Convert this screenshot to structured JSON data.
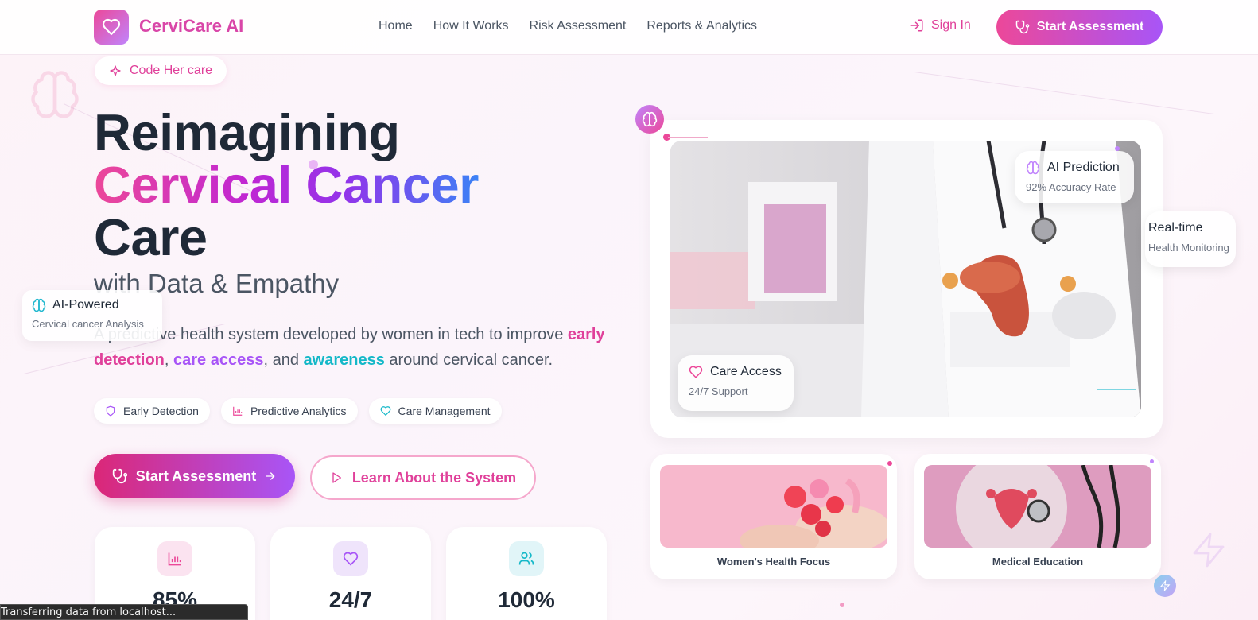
{
  "header": {
    "brand": "CerviCare AI",
    "nav": [
      "Home",
      "How It Works",
      "Risk Assessment",
      "Reports & Analytics"
    ],
    "sign_in": "Sign In",
    "start_assessment": "Start Assessment"
  },
  "hero": {
    "badge": "Code Her care",
    "title_line1": "Reimagining",
    "title_line2": "Cervical Cancer",
    "title_line3": "Care",
    "subtitle": "with Data & Empathy",
    "desc_part1": "A predictive health system developed by women in tech to improve",
    "desc_hl1": "early detection",
    "desc_sep1": ",",
    "desc_hl2": "care access",
    "desc_sep2": ", and",
    "desc_hl3": "awareness",
    "desc_part2": "around cervical cancer.",
    "pills": [
      "Early Detection",
      "Predictive Analytics",
      "Care Management"
    ],
    "primary_button": "Start Assessment",
    "secondary_button": "Learn About the System",
    "ai_powered_title": "AI-Powered",
    "ai_powered_sub": "Cervical cancer Analysis"
  },
  "stats": [
    {
      "value": "85%",
      "icon": "bar-chart-icon"
    },
    {
      "value": "24/7",
      "icon": "heart-icon"
    },
    {
      "value": "100%",
      "icon": "users-icon"
    }
  ],
  "showcase": {
    "ai_prediction_title": "AI Prediction",
    "ai_prediction_sub": "92% Accuracy Rate",
    "realtime_title": "Real-time",
    "realtime_sub": "Health Monitoring",
    "care_access_title": "Care Access",
    "care_access_sub": "24/7 Support",
    "card1_caption": "Women's Health Focus",
    "card2_caption": "Medical Education"
  },
  "status_bar": "Transferring data from localhost...",
  "colors": {
    "pink": "#ec4899",
    "purple": "#a855f7",
    "teal": "#14b8c8",
    "dark": "#1f2937"
  }
}
